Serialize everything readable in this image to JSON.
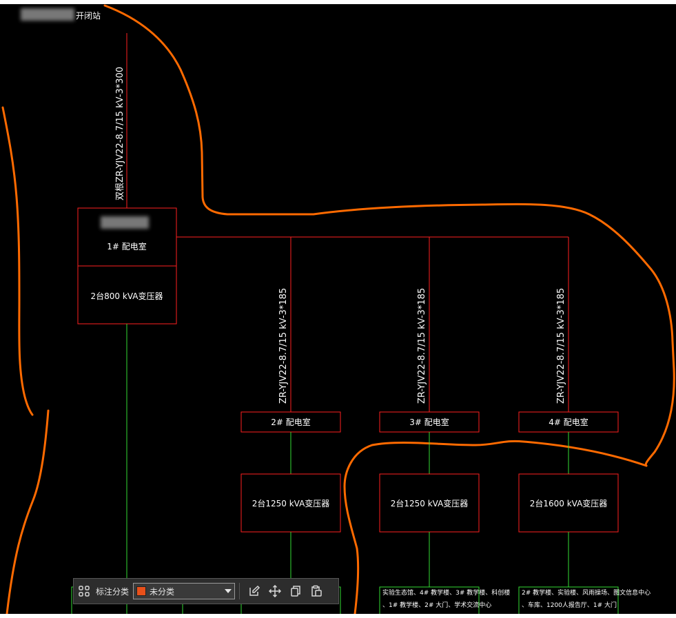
{
  "top_label": "开闭站",
  "main_cable": "双根ZR-YJV22-8.7/15 kV-3*300",
  "room1": {
    "name": "1# 配电室",
    "transformer": "2台800 kVA变压器"
  },
  "branches": [
    {
      "cable": "ZR-YJV22-8.7/15 kV-3*185",
      "room": "2# 配电室",
      "transformer": "2台1250 kVA变压器",
      "loads": [
        "",
        ""
      ]
    },
    {
      "cable": "ZR-YJV22-8.7/15 kV-3*185",
      "room": "3# 配电室",
      "transformer": "2台1250 kVA变压器",
      "loads": [
        "实验生态馆、4# 教学楼、3# 教学楼、科创楼",
        "、1# 教学楼、2# 大门、学术交流中心"
      ]
    },
    {
      "cable": "ZR-YJV22-8.7/15 kV-3*185",
      "room": "4# 配电室",
      "transformer": "2台1600 kVA变压器",
      "loads": [
        "2# 教学楼、实验楼、风雨操场、图文信息中心",
        "、车库、1200人报告厅、1# 大门"
      ]
    }
  ],
  "colors": {
    "background": "#000000",
    "box": "#ff2020",
    "feeder": "#ff2020",
    "load": "#33dd33",
    "boundary": "#ff6a00",
    "text": "#ffffff"
  },
  "toolbar": {
    "category_label": "标注分类",
    "selected": "未分类",
    "swatch_color": "#e8501a",
    "icons": [
      "grid-icon",
      "edit-icon",
      "move-icon",
      "copy-icon",
      "paste-icon"
    ]
  }
}
